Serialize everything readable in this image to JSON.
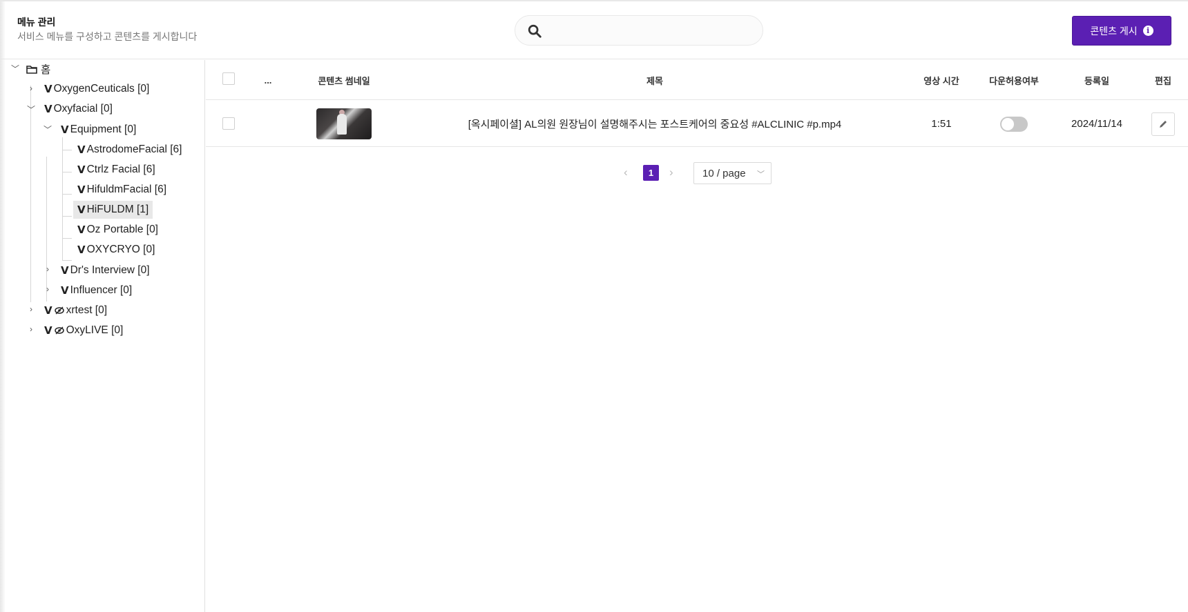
{
  "header": {
    "title": "메뉴 관리",
    "subtitle": "서비스 메뉴를 구성하고 콘텐츠를 게시합니다",
    "search_placeholder": "",
    "post_button_label": "콘텐츠 게시",
    "accent_color": "#5b1fb3"
  },
  "tree": {
    "root": {
      "label": "홈",
      "icon": "folder-icon",
      "expanded": true
    },
    "nodes": [
      {
        "label": "OxygenCeuticals [0]",
        "expanded": false,
        "hidden": false
      },
      {
        "label": "Oxyfacial [0]",
        "expanded": true,
        "hidden": false
      },
      {
        "label": "Equipment [0]",
        "expanded": true,
        "hidden": false
      },
      {
        "label": "AstrodomeFacial [6]",
        "hidden": false
      },
      {
        "label": "Ctrlz Facial [6]",
        "hidden": false
      },
      {
        "label": "HifuldmFacial [6]",
        "hidden": false
      },
      {
        "label": "HiFULDM [1]",
        "selected": true,
        "hidden": false
      },
      {
        "label": "Oz Portable [0]",
        "hidden": false
      },
      {
        "label": "OXYCRYO [0]",
        "hidden": false
      },
      {
        "label": "Dr's Interview [0]",
        "expanded": false,
        "hidden": false
      },
      {
        "label": "Influencer [0]",
        "expanded": false,
        "hidden": false
      },
      {
        "label": "xrtest [0]",
        "expanded": false,
        "hidden": true
      },
      {
        "label": "OxyLIVE [0]",
        "expanded": false,
        "hidden": true
      }
    ],
    "v_glyph": "V"
  },
  "table": {
    "columns": {
      "more": "...",
      "thumbnail": "콘텐츠 썸네일",
      "title": "제목",
      "duration": "영상 시간",
      "download": "다운허용여부",
      "date": "등록일",
      "edit": "편집"
    },
    "rows": [
      {
        "title": "[옥시페이셜] AL의원 원장님이 설명해주시는 포스트케어의 중요성 #ALCLINIC #p.mp4",
        "duration": "1:51",
        "download_allowed": false,
        "date": "2024/11/14"
      }
    ]
  },
  "pagination": {
    "current_page": "1",
    "page_size": "10 / page",
    "prev": "‹",
    "next": "›"
  }
}
